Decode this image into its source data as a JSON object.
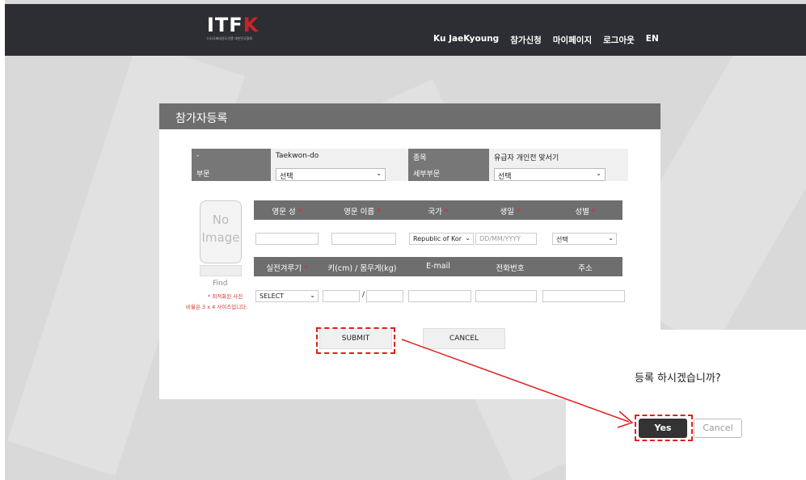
{
  "header": {
    "logo_text": "ITF",
    "logo_k": "K",
    "logo_sub": "(사)국제태권도연맹 대한민국협회",
    "nav": [
      "Ku JaeKyoung",
      "참가신청",
      "마이페이지",
      "로그아웃",
      "EN"
    ]
  },
  "panel": {
    "title": "참가자등록",
    "info": {
      "row1": {
        "label1": "-",
        "value1": "Taekwon-do",
        "label2": "종목",
        "value2": "유급자 개인전 맞서기"
      },
      "row2": {
        "label1": "부문",
        "select1": "선택",
        "label2": "세부부문",
        "select2": "선택"
      }
    },
    "photo": {
      "line1": "No",
      "line2": "Image",
      "find": "Find",
      "note1": "* 최적화된 사진",
      "note2": "비율은 3 x 4 사이즈입니다."
    },
    "headers1": [
      "영문 성",
      "영문 이름",
      "국가",
      "생일",
      "성별"
    ],
    "headers2": [
      "실전겨루기",
      "키(cm) / 몸무게(kg)",
      "E-mail",
      "전화번호",
      "주소"
    ],
    "inputs": {
      "country": "Republic of Kor",
      "birthday_placeholder": "DD/MM/YYYY",
      "gender": "선택",
      "sparring": "SELECT",
      "slash": "/"
    },
    "submit_label": "SUBMIT",
    "cancel_label": "CANCEL"
  },
  "dialog": {
    "message": "등록 하시겠습니까?",
    "yes_label": "Yes",
    "cancel_label": "Cancel"
  },
  "colors": {
    "header_bg": "#2d2e33",
    "panel_header": "#6e6e6e",
    "required": "#e22233",
    "annotation": "#e0201e",
    "yes_bg": "#333333"
  },
  "icons": [
    "chevron-down-icon",
    "arrow-annotation"
  ]
}
